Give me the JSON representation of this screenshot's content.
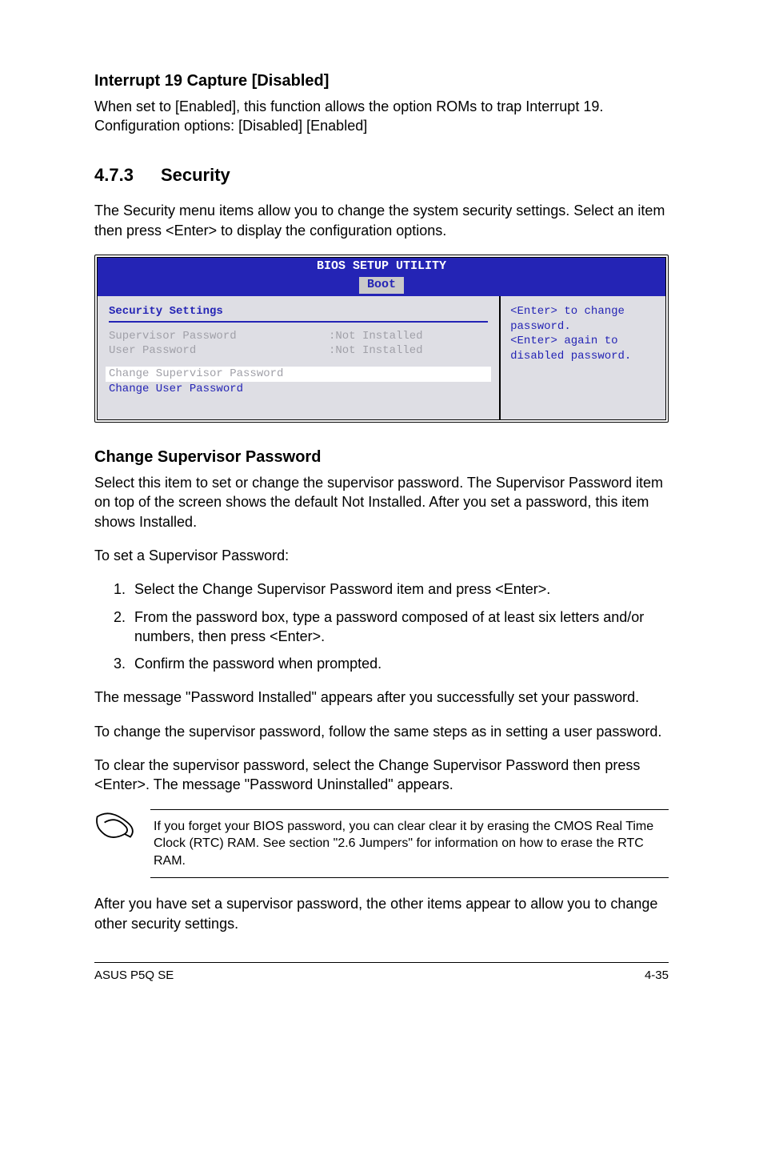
{
  "sec1": {
    "title": "Interrupt 19 Capture [Disabled]",
    "body": "When set to [Enabled], this function allows the option ROMs to trap Interrupt 19. Configuration options: [Disabled] [Enabled]"
  },
  "sec473": {
    "num": "4.7.3",
    "title": "Security",
    "intro": "The Security menu items allow you to change the system security settings. Select an item then press <Enter> to display the configuration options."
  },
  "bios": {
    "header": "BIOS SETUP UTILITY",
    "tab": "Boot",
    "panel_title": "Security Settings",
    "rows": [
      {
        "label": "Supervisor Password",
        "val": ":Not Installed"
      },
      {
        "label": "User Password",
        "val": ":Not Installed"
      }
    ],
    "link_rows": [
      "Change Supervisor Password",
      "Change User Password"
    ],
    "help": "<Enter> to change password.\n<Enter> again to disabled password."
  },
  "csp": {
    "title": "Change Supervisor Password",
    "p1": "Select this item to set or change the supervisor password. The Supervisor Password item on top of the screen shows the default Not Installed. After you set a password, this item shows Installed.",
    "p2": "To set a Supervisor Password:",
    "steps": [
      "Select the Change Supervisor Password item and press <Enter>.",
      "From the password box, type a password composed of at least six letters and/or numbers, then press <Enter>.",
      "Confirm the password when prompted."
    ],
    "p3": "The message \"Password Installed\" appears after you successfully set your password.",
    "p4": "To change the supervisor password, follow the same steps as in setting a user password.",
    "p5": "To clear the supervisor password, select the Change Supervisor Password then press <Enter>. The message \"Password Uninstalled\" appears.",
    "note": "If you forget your BIOS password, you can clear clear it by erasing the CMOS Real Time Clock (RTC) RAM. See section \"2.6 Jumpers\" for information on how to erase the RTC RAM.",
    "p6": "After you have set a supervisor password, the other items appear to allow you to change other security settings."
  },
  "footer": {
    "left": "ASUS P5Q SE",
    "right": "4-35"
  }
}
